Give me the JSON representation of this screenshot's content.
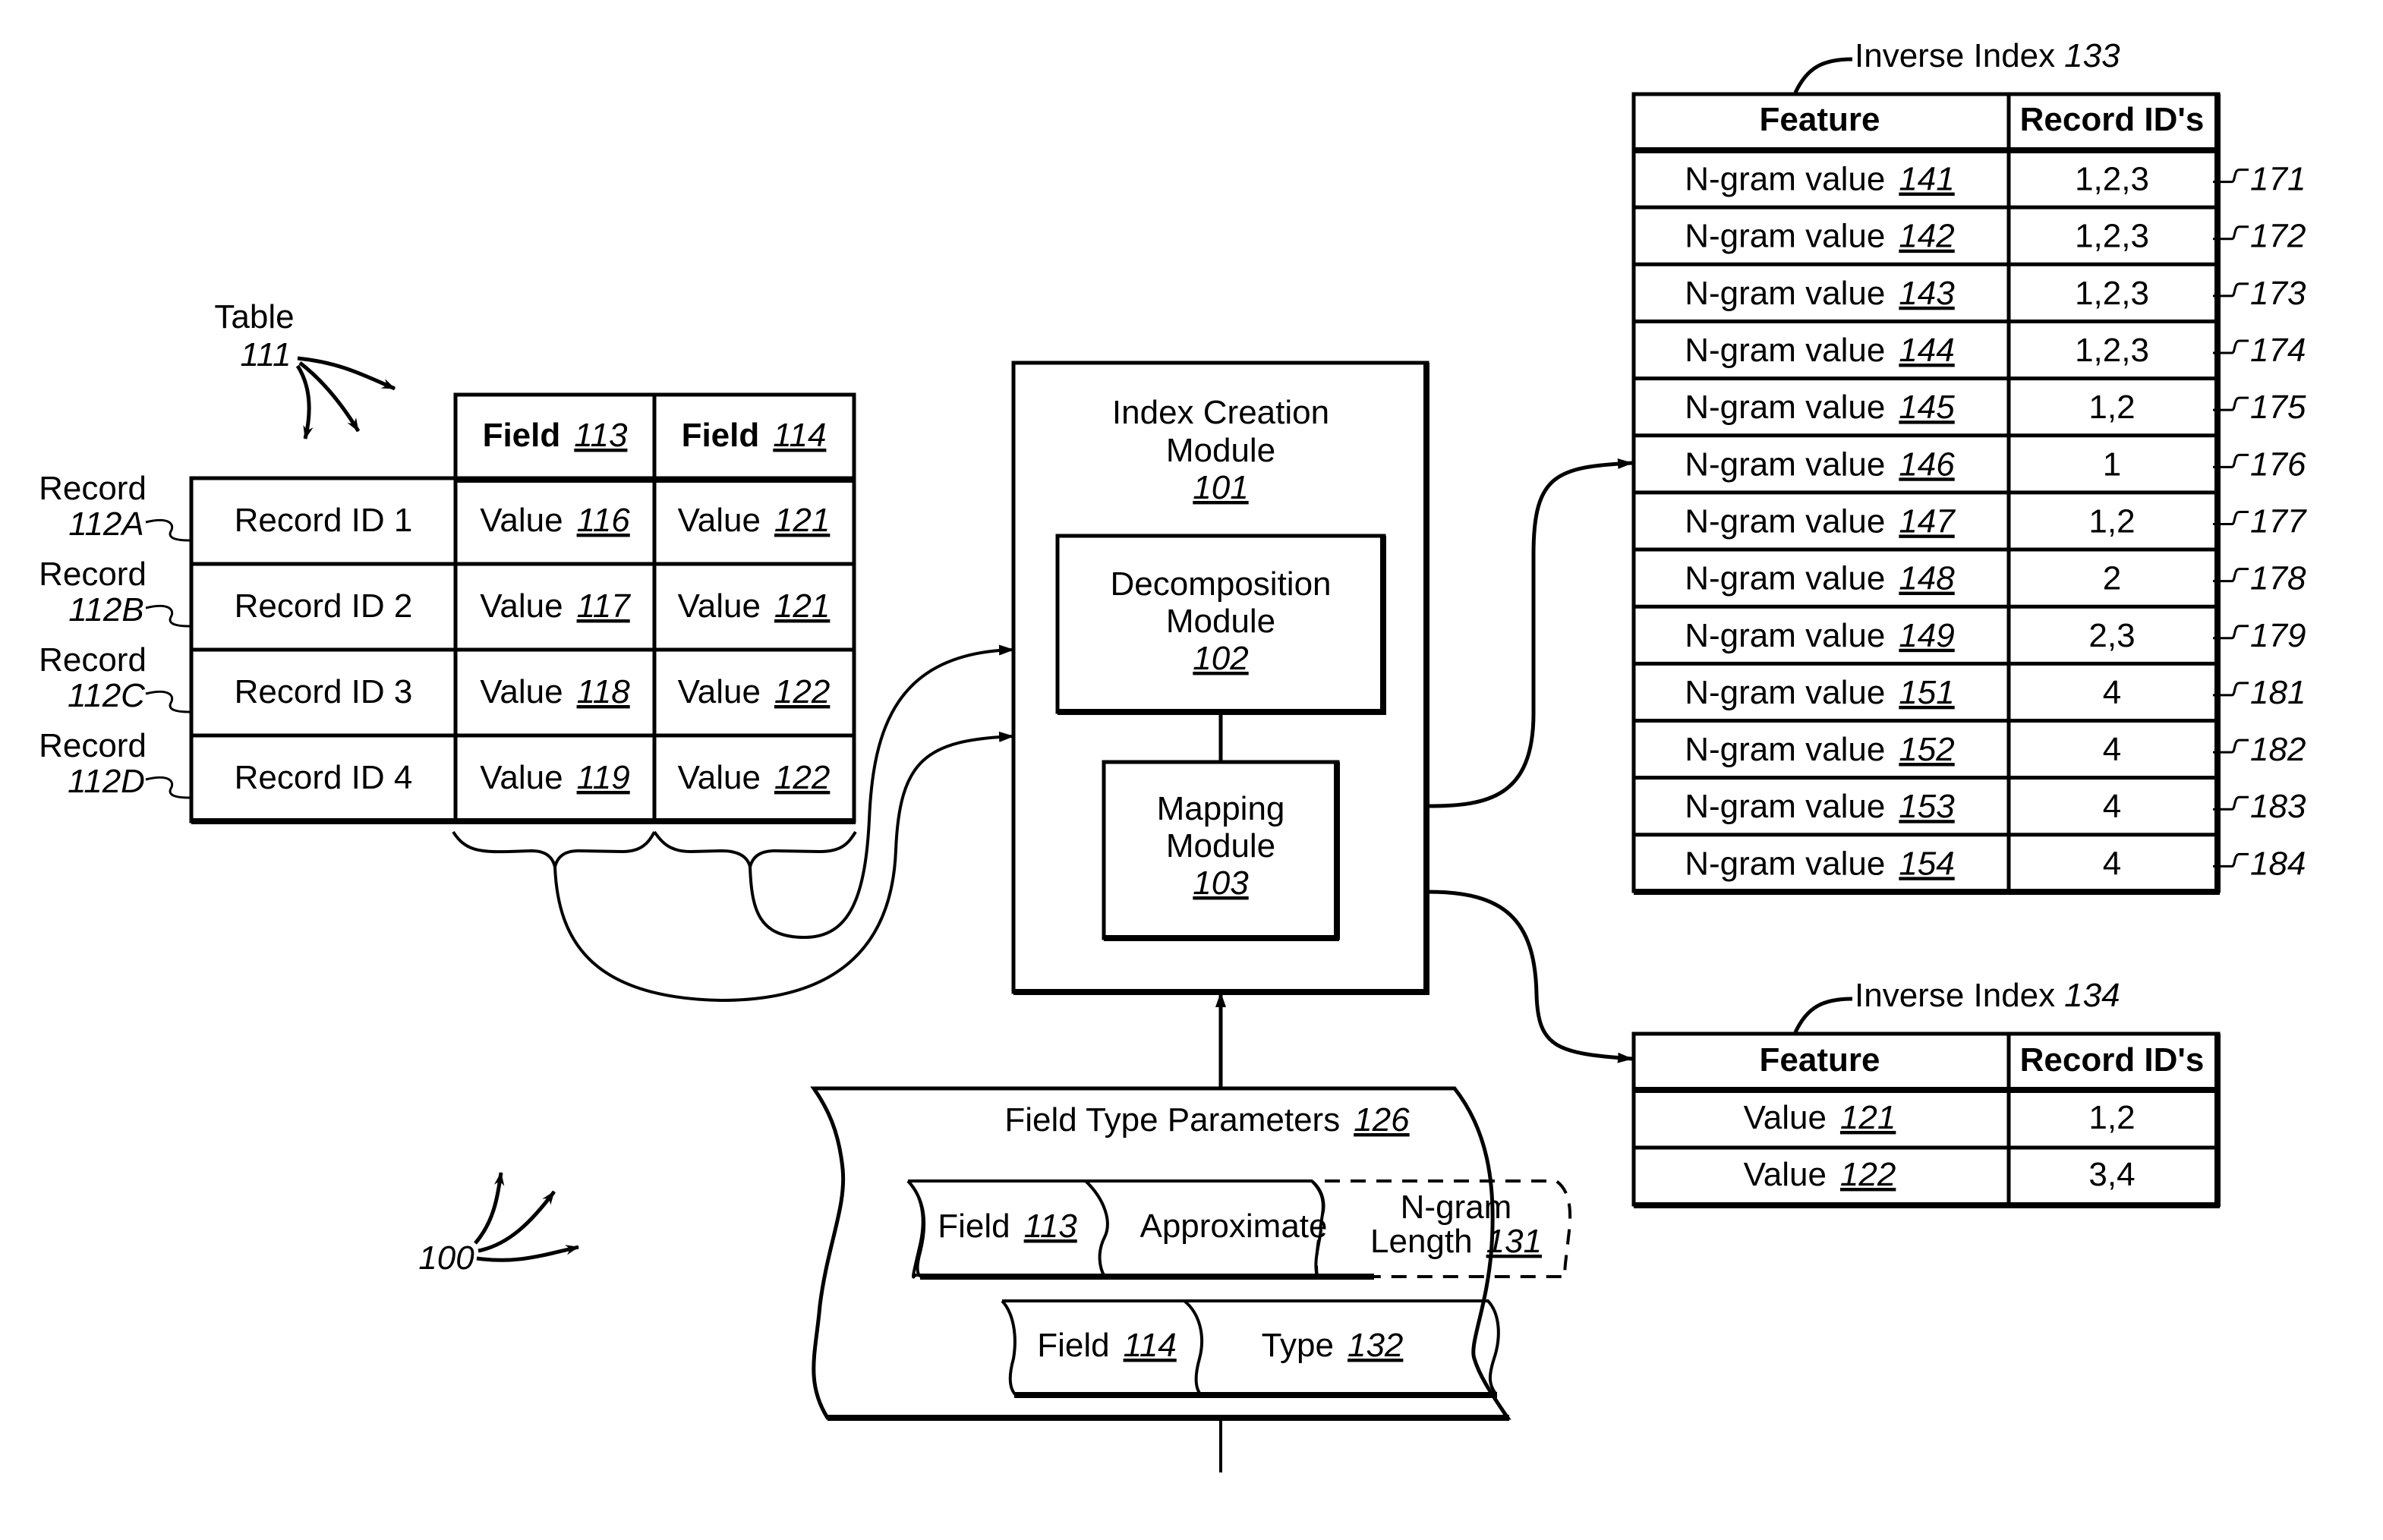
{
  "figure_label": "100",
  "table": {
    "label": "Table",
    "ref": "111",
    "columns": [
      {
        "label": "Field",
        "ref": "113"
      },
      {
        "label": "Field",
        "ref": "114"
      }
    ],
    "rows": [
      {
        "record_label": "Record",
        "record_ref": "112A",
        "id": "Record ID 1",
        "v1_label": "Value",
        "v1_ref": "116",
        "v2_label": "Value",
        "v2_ref": "121"
      },
      {
        "record_label": "Record",
        "record_ref": "112B",
        "id": "Record ID 2",
        "v1_label": "Value",
        "v1_ref": "117",
        "v2_label": "Value",
        "v2_ref": "121"
      },
      {
        "record_label": "Record",
        "record_ref": "112C",
        "id": "Record ID 3",
        "v1_label": "Value",
        "v1_ref": "118",
        "v2_label": "Value",
        "v2_ref": "122"
      },
      {
        "record_label": "Record",
        "record_ref": "112D",
        "id": "Record ID 4",
        "v1_label": "Value",
        "v1_ref": "119",
        "v2_label": "Value",
        "v2_ref": "122"
      }
    ]
  },
  "index_module": {
    "title_line1": "Index Creation",
    "title_line2": "Module",
    "ref": "101",
    "decomposition": {
      "line1": "Decomposition",
      "line2": "Module",
      "ref": "102"
    },
    "mapping": {
      "line1": "Mapping",
      "line2": "Module",
      "ref": "103"
    }
  },
  "field_type_parameters": {
    "title": "Field Type Parameters",
    "ref": "126",
    "row1": {
      "field_label": "Field",
      "field_ref": "113",
      "type": "Approximate",
      "extra_line1": "N-gram",
      "extra_line2": "Length",
      "extra_ref": "131"
    },
    "row2": {
      "field_label": "Field",
      "field_ref": "114",
      "type_label": "Type",
      "type_ref": "132"
    }
  },
  "inverse_index_133": {
    "title": "Inverse Index",
    "ref": "133",
    "headers": [
      "Feature",
      "Record ID's"
    ],
    "rows": [
      {
        "feature": "N-gram value",
        "feature_ref": "141",
        "ids": "1,2,3",
        "row_ref": "171"
      },
      {
        "feature": "N-gram value",
        "feature_ref": "142",
        "ids": "1,2,3",
        "row_ref": "172"
      },
      {
        "feature": "N-gram value",
        "feature_ref": "143",
        "ids": "1,2,3",
        "row_ref": "173"
      },
      {
        "feature": "N-gram value",
        "feature_ref": "144",
        "ids": "1,2,3",
        "row_ref": "174"
      },
      {
        "feature": "N-gram value",
        "feature_ref": "145",
        "ids": "1,2",
        "row_ref": "175"
      },
      {
        "feature": "N-gram value",
        "feature_ref": "146",
        "ids": "1",
        "row_ref": "176"
      },
      {
        "feature": "N-gram value",
        "feature_ref": "147",
        "ids": "1,2",
        "row_ref": "177"
      },
      {
        "feature": "N-gram value",
        "feature_ref": "148",
        "ids": "2",
        "row_ref": "178"
      },
      {
        "feature": "N-gram value",
        "feature_ref": "149",
        "ids": "2,3",
        "row_ref": "179"
      },
      {
        "feature": "N-gram value",
        "feature_ref": "151",
        "ids": "4",
        "row_ref": "181"
      },
      {
        "feature": "N-gram value",
        "feature_ref": "152",
        "ids": "4",
        "row_ref": "182"
      },
      {
        "feature": "N-gram value",
        "feature_ref": "153",
        "ids": "4",
        "row_ref": "183"
      },
      {
        "feature": "N-gram value",
        "feature_ref": "154",
        "ids": "4",
        "row_ref": "184"
      }
    ]
  },
  "inverse_index_134": {
    "title": "Inverse Index",
    "ref": "134",
    "headers": [
      "Feature",
      "Record ID's"
    ],
    "rows": [
      {
        "feature": "Value",
        "feature_ref": "121",
        "ids": "1,2"
      },
      {
        "feature": "Value",
        "feature_ref": "122",
        "ids": "3,4"
      }
    ]
  }
}
